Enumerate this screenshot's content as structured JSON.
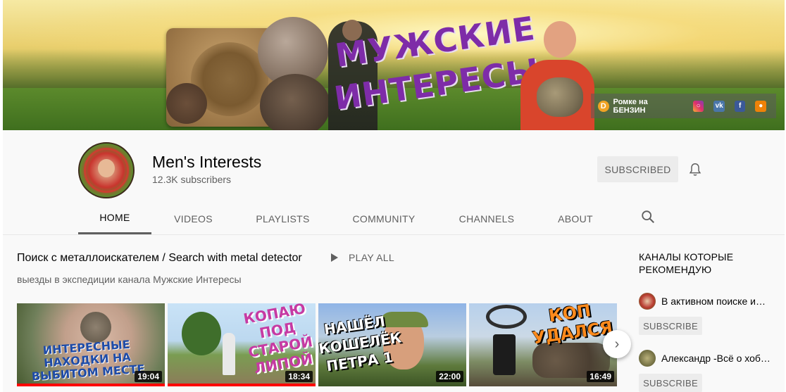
{
  "banner": {
    "title_line1": "МУЖСКИЕ",
    "title_line2": "ИНТЕРЕСЫ",
    "links": {
      "donate_label": "Ромке на БЕНЗИН",
      "icons": [
        "donationalerts-icon",
        "instagram-icon",
        "vk-icon",
        "facebook-icon",
        "odnoklassniki-icon"
      ]
    }
  },
  "channel": {
    "name": "Men's Interests",
    "subscribers": "12.3K subscribers",
    "subscribe_label": "SUBSCRIBED"
  },
  "tabs": [
    {
      "label": "HOME",
      "active": true
    },
    {
      "label": "VIDEOS"
    },
    {
      "label": "PLAYLISTS"
    },
    {
      "label": "COMMUNITY"
    },
    {
      "label": "CHANNELS"
    },
    {
      "label": "ABOUT"
    }
  ],
  "shelf": {
    "title": "Поиск с металлоискателем / Search with metal detector",
    "play_all": "PLAY ALL",
    "description": "выезды в экспедиции канала Мужские Интересы",
    "videos": [
      {
        "caption": "ИНТЕРЕСНЫЕ НАХОДКИ НА ВЫБИТОМ МЕСТЕ",
        "duration": "19:04",
        "watched": 1.0
      },
      {
        "caption": "КОПАЮ ПОД СТАРОЙ ЛИПОЙ",
        "duration": "18:34",
        "watched": 1.0
      },
      {
        "caption": "НАШЁЛ КОШЕЛЁК ПЕТРА 1",
        "duration": "22:00",
        "watched": 0
      },
      {
        "caption": "КОП УДАЛСЯ",
        "duration": "16:49",
        "watched": 0
      }
    ]
  },
  "sidebar": {
    "title": "КАНАЛЫ КОТОРЫЕ РЕКОМЕНДУЮ",
    "channels": [
      {
        "name": "В активном поиске и…",
        "button": "SUBSCRIBE"
      },
      {
        "name": "Александр -Всё о хоб…",
        "button": "SUBSCRIBE"
      }
    ]
  },
  "colors": {
    "accent_red": "#ff0000",
    "text_primary": "#030303",
    "text_secondary": "#606060",
    "banner_title": "#7e2ca8"
  }
}
